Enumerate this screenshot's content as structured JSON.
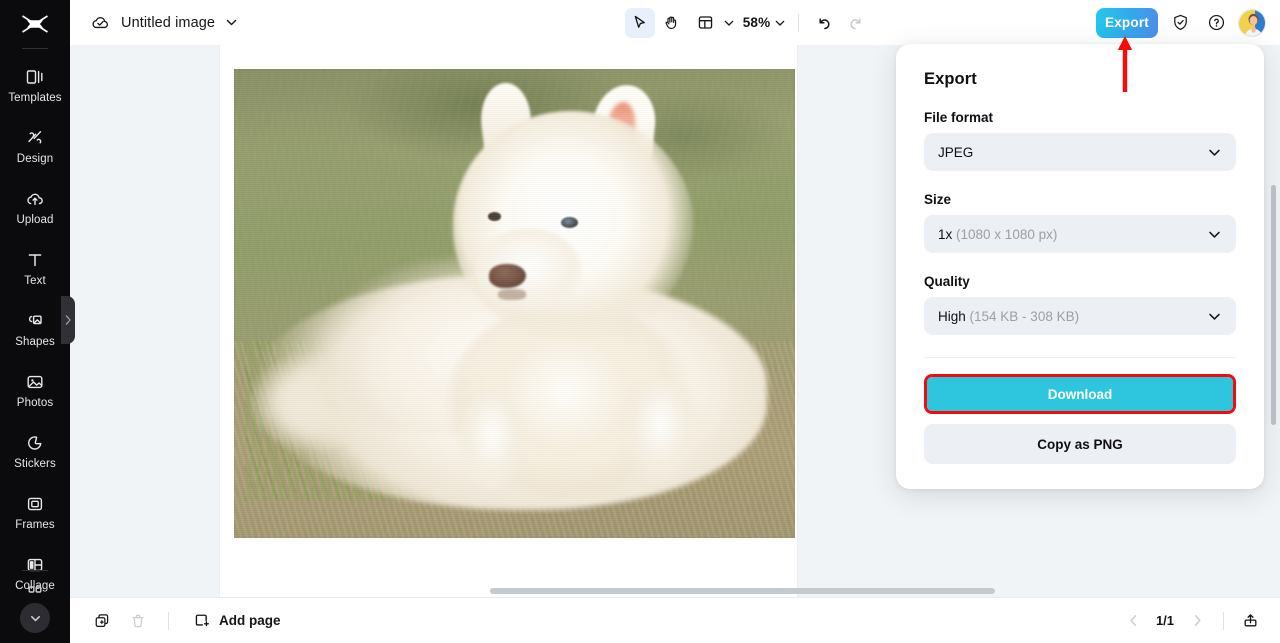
{
  "app": {
    "logo_icon": "capcut-logo-icon",
    "accent_cyan": "#2ec6de",
    "accent_blue": "#4f8bea",
    "highlight_red": "#f40b0b",
    "sidebar_bg": "#0b0b0d"
  },
  "sidebar": {
    "items": [
      {
        "label": "Templates",
        "icon": "templates-icon"
      },
      {
        "label": "Design",
        "icon": "design-icon"
      },
      {
        "label": "Upload",
        "icon": "upload-cloud-icon"
      },
      {
        "label": "Text",
        "icon": "text-icon"
      },
      {
        "label": "Shapes",
        "icon": "shapes-icon"
      },
      {
        "label": "Photos",
        "icon": "photos-icon"
      },
      {
        "label": "Stickers",
        "icon": "stickers-icon"
      },
      {
        "label": "Frames",
        "icon": "frames-icon"
      },
      {
        "label": "Collage",
        "icon": "collage-icon"
      }
    ],
    "collapse_icon": "chevron-down-icon",
    "panel_handle_icon": "chevron-right-icon"
  },
  "topbar": {
    "cloud_icon": "cloud-saved-icon",
    "doc_title": "Untitled image",
    "title_chevron_icon": "chevron-down-icon",
    "tools": [
      {
        "name": "select-tool",
        "icon": "cursor-arrow-icon",
        "active": true
      },
      {
        "name": "hand-tool",
        "icon": "hand-icon",
        "active": false
      },
      {
        "name": "layout-tool",
        "icon": "layout-grid-icon",
        "active": false
      }
    ],
    "layout_chevron_icon": "chevron-down-icon",
    "zoom_level": "58%",
    "zoom_chevron_icon": "chevron-down-icon",
    "undo_icon": "undo-arrow-icon",
    "redo_icon": "redo-arrow-icon",
    "export_label": "Export",
    "shield_icon": "shield-check-icon",
    "help_icon": "question-mark-icon",
    "avatar_icon": "user-avatar"
  },
  "canvas": {
    "artwork_alt": "white samoyed husky puppy lying on grass",
    "hscrollbar": "horizontal-scrollbar"
  },
  "export_panel": {
    "title": "Export",
    "file_format": {
      "label": "File format",
      "value": "JPEG",
      "chevron_icon": "chevron-down-icon"
    },
    "size": {
      "label": "Size",
      "value_bold": "1x",
      "value_muted": "(1080 x 1080 px)",
      "chevron_icon": "chevron-down-icon"
    },
    "quality": {
      "label": "Quality",
      "value_bold": "High",
      "value_muted": "(154 KB - 308 KB)",
      "chevron_icon": "chevron-down-icon"
    },
    "download_label": "Download",
    "copy_label": "Copy as PNG"
  },
  "bottombar": {
    "duplicate_icon": "duplicate-page-icon",
    "delete_icon": "trash-icon",
    "add_page_icon": "add-page-icon",
    "add_page_label": "Add page",
    "prev_icon": "chevron-left-icon",
    "page_count": "1/1",
    "next_icon": "chevron-right-icon",
    "export_share_icon": "upload-share-icon"
  },
  "annotation": {
    "arrow": "red-up-arrow-pointing-at-export-button",
    "download_highlight": "red-rectangle-around-download-button"
  }
}
